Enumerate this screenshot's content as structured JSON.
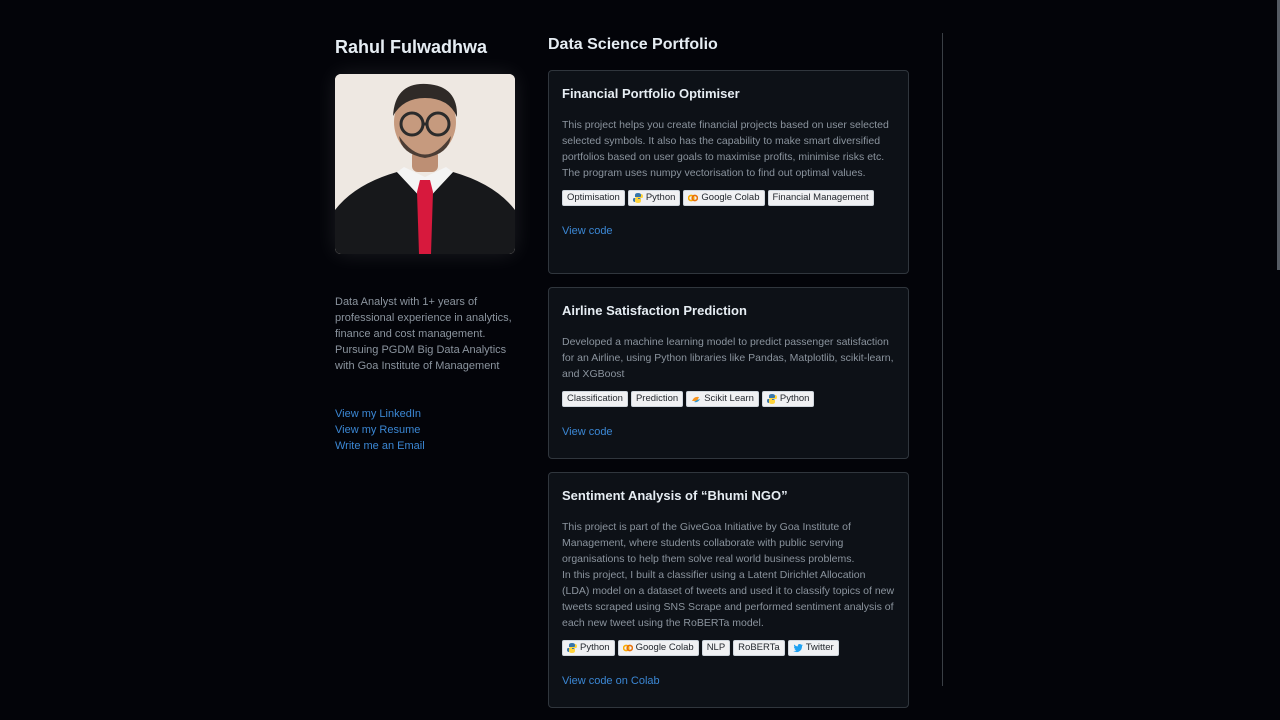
{
  "profile": {
    "name": "Rahul Fulwadhwa",
    "bio": "Data Analyst with 1+ years of professional experience in analytics, finance and cost management. Pursuing PGDM Big Data Analytics with Goa Institute of Management",
    "links": [
      "View my LinkedIn",
      "View my Resume",
      "Write me an Email"
    ]
  },
  "portfolio": {
    "title": "Data Science Portfolio",
    "projects": [
      {
        "title": "Financial Portfolio Optimiser",
        "description": "This project helps you create financial projects based on user selected selected symbols. It also has the capability to make smart diversified portfolios based on user goals to maximise profits, minimise risks etc.\nThe program uses numpy vectorisation to find out optimal values.",
        "tags": [
          {
            "label": "Optimisation",
            "icon": ""
          },
          {
            "label": "Python",
            "icon": "python-icon"
          },
          {
            "label": "Google Colab",
            "icon": "colab-icon"
          },
          {
            "label": "Financial Management",
            "icon": ""
          }
        ],
        "link": "View code"
      },
      {
        "title": "Airline Satisfaction Prediction",
        "description": "Developed a machine learning model to predict passenger satisfaction for an Airline, using Python libraries like Pandas, Matplotlib, scikit-learn, and XGBoost",
        "tags": [
          {
            "label": "Classification",
            "icon": ""
          },
          {
            "label": "Prediction",
            "icon": ""
          },
          {
            "label": "Scikit Learn",
            "icon": "scikit-learn-icon"
          },
          {
            "label": "Python",
            "icon": "python-icon"
          }
        ],
        "link": "View code"
      },
      {
        "title": "Sentiment Analysis of “Bhumi NGO”",
        "description": "This project is part of the GiveGoa Initiative by Goa Institute of Management, where students collaborate with public serving organisations to help them solve real world business problems.\nIn this project, I built a classifier using a Latent Dirichlet Allocation (LDA) model on a dataset of tweets and used it to classify topics of new tweets scraped using SNS Scrape and performed sentiment analysis of each new tweet using the RoBERTa model.",
        "tags": [
          {
            "label": "Python",
            "icon": "python-icon"
          },
          {
            "label": "Google Colab",
            "icon": "colab-icon"
          },
          {
            "label": "NLP",
            "icon": ""
          },
          {
            "label": "RoBERTa",
            "icon": ""
          },
          {
            "label": "Twitter",
            "icon": "twitter-icon"
          }
        ],
        "link": "View code on Colab"
      }
    ]
  },
  "colors": {
    "background": "#030409",
    "card": "#0d1117",
    "link": "#3b87d4",
    "muted_text": "#8b949e"
  }
}
